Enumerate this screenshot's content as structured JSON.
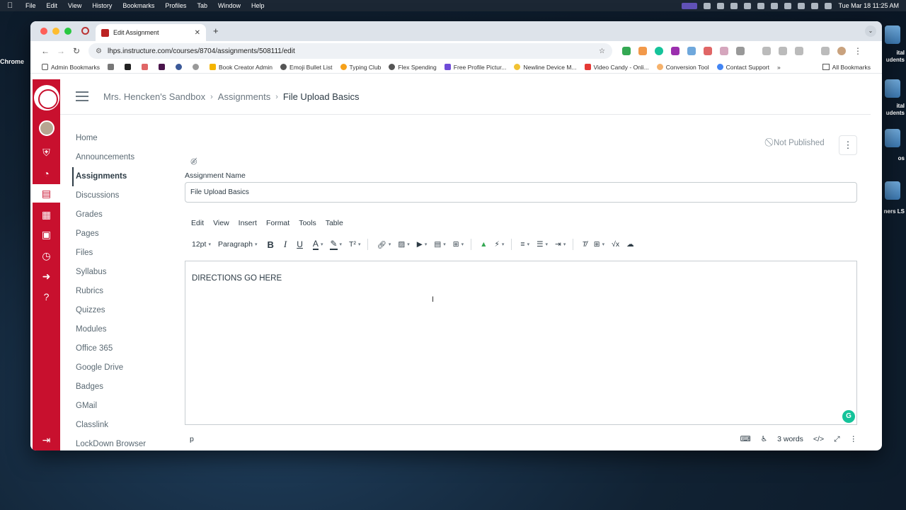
{
  "menubar": {
    "app": "Chrome",
    "items": [
      "File",
      "Edit",
      "View",
      "History",
      "Bookmarks",
      "Profiles",
      "Tab",
      "Window",
      "Help"
    ],
    "clock": "Tue Mar 18  11:25 AM"
  },
  "desktop": {
    "labels": [
      "ital",
      "udents",
      "ital",
      "udents",
      "os",
      "ners LS"
    ]
  },
  "browser": {
    "tab_title": "Edit Assignment",
    "url": "lhps.instructure.com/courses/8704/assignments/508111/edit",
    "bookmarks": [
      "Admin Bookmarks",
      "Book Creator Admin",
      "Emoji Bullet List",
      "Typing Club",
      "Flex Spending",
      "Free Profile Pictur...",
      "Newline Device M...",
      "Video Candy - Onli...",
      "Conversion Tool",
      "Contact Support"
    ],
    "all_bookmarks": "All Bookmarks"
  },
  "breadcrumb": {
    "course": "Mrs. Hencken's Sandbox",
    "section": "Assignments",
    "current": "File Upload Basics"
  },
  "course_nav": [
    "Home",
    "Announcements",
    "Assignments",
    "Discussions",
    "Grades",
    "Pages",
    "Files",
    "Syllabus",
    "Rubrics",
    "Quizzes",
    "Modules",
    "Office 365",
    "Google Drive",
    "Badges",
    "GMail",
    "Classlink",
    "LockDown Browser"
  ],
  "publish_status": "Not Published",
  "form": {
    "name_label": "Assignment Name",
    "name_value": "File Upload Basics"
  },
  "editor": {
    "menus": [
      "Edit",
      "View",
      "Insert",
      "Format",
      "Tools",
      "Table"
    ],
    "font_size": "12pt",
    "block_format": "Paragraph",
    "content": "DIRECTIONS GO HERE",
    "path": "p",
    "word_count": "3 words",
    "html_toggle": "</>",
    "grammarly_letter": "G"
  },
  "colors": {
    "brand_red": "#c8102e",
    "text_dark": "#2d3b45",
    "text_muted": "#6b7780"
  }
}
